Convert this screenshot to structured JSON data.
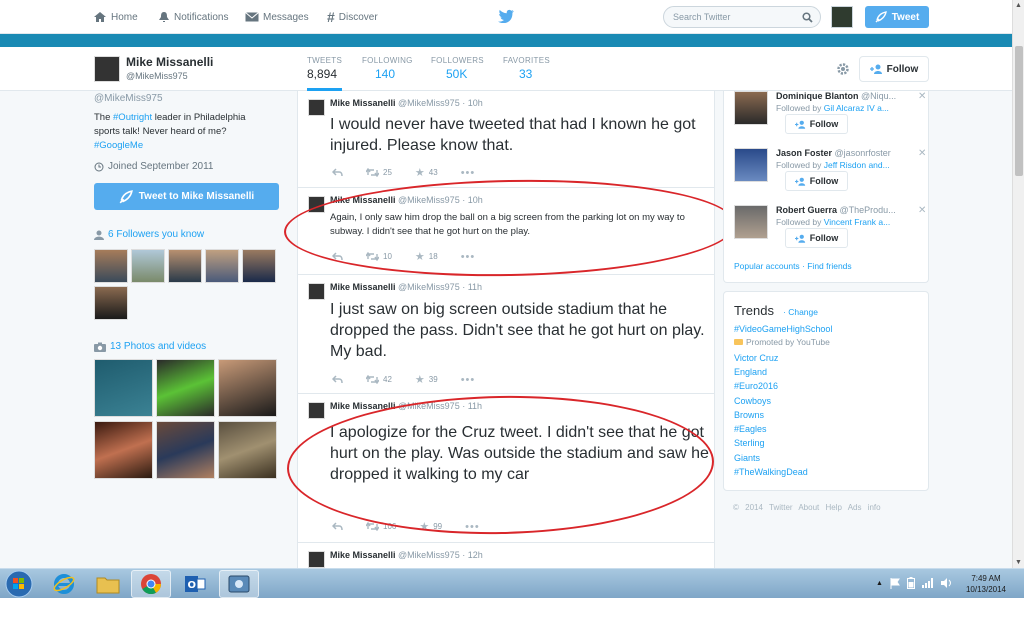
{
  "nav": {
    "home": "Home",
    "notifications": "Notifications",
    "messages": "Messages",
    "discover": "Discover",
    "search_placeholder": "Search Twitter",
    "tweet_button": "Tweet"
  },
  "profile": {
    "name": "Mike Missanelli",
    "handle": "@MikeMiss975",
    "stats": [
      {
        "label": "TWEETS",
        "value": "8,894"
      },
      {
        "label": "FOLLOWING",
        "value": "140"
      },
      {
        "label": "FOLLOWERS",
        "value": "50K"
      },
      {
        "label": "FAVORITES",
        "value": "33"
      }
    ],
    "follow_button": "Follow"
  },
  "sidebar": {
    "handle": "@MikeMiss975",
    "bio_pre": "The ",
    "bio_tag": "#Outright",
    "bio_mid": " leader in Philadelphia sports talk! Never heard of me? ",
    "bio_tag2": "#GoogleMe",
    "joined": "Joined September 2011",
    "tweet_to": "Tweet to Mike Missanelli",
    "followers_you_know": "6 Followers you know",
    "photos_videos": "13 Photos and videos"
  },
  "tweets": [
    {
      "name": "Mike Missanelli",
      "handle": "@MikeMiss975",
      "time": "10h",
      "text": "I would never have tweeted that had I known he got injured. Please know that.",
      "retweets": "25",
      "favorites": "43"
    },
    {
      "name": "Mike Missanelli",
      "handle": "@MikeMiss975",
      "time": "10h",
      "text": "Again, I only saw him drop the ball on a big screen from the parking lot on my way to subway. I didn't see that he got hurt on the play.",
      "retweets": "10",
      "favorites": "18"
    },
    {
      "name": "Mike Missanelli",
      "handle": "@MikeMiss975",
      "time": "11h",
      "text": "I just saw on big screen outside stadium that he dropped the pass. Didn't see that he got hurt on play. My bad.",
      "retweets": "42",
      "favorites": "39"
    },
    {
      "name": "Mike Missanelli",
      "handle": "@MikeMiss975",
      "time": "11h",
      "text": "I apologize for the Cruz tweet. I didn't see that he got hurt on the play. Was outside the stadium and saw he dropped it walking to my car",
      "retweets": "106",
      "favorites": "99"
    },
    {
      "name": "Mike Missanelli",
      "handle": "@MikeMiss975",
      "time": "12h"
    }
  ],
  "who_to_follow": [
    {
      "name": "Dominique Blanton",
      "handle": "@Niqu...",
      "followed_pre": "Followed by ",
      "followed_by": "Gil Alcaraz IV a...",
      "button": "Follow"
    },
    {
      "name": "Jason Foster",
      "handle": "@jasonrfoster",
      "followed_pre": "Followed by ",
      "followed_by": "Jeff Risdon and...",
      "button": "Follow"
    },
    {
      "name": "Robert Guerra",
      "handle": "@TheProdu...",
      "followed_pre": "Followed by ",
      "followed_by": "Vincent Frank a...",
      "button": "Follow"
    }
  ],
  "popular_links": "Popular accounts · Find friends",
  "trends": {
    "title": "Trends",
    "change": "Change",
    "promoted_tag": "#VideoGameHighSchool",
    "promoted_by": "Promoted by YouTube",
    "items": [
      "Victor Cruz",
      "England",
      "#Euro2016",
      "Cowboys",
      "Browns",
      "#Eagles",
      "Sterling",
      "Giants",
      "#TheWalkingDead"
    ]
  },
  "footer": "© 2014 Twitter About Help Ads info",
  "taskbar": {
    "time": "7:49 AM",
    "date": "10/13/2014"
  },
  "colors": {
    "twitter_blue": "#55acee",
    "link": "#1da1f2",
    "annotation_red": "#d9262a",
    "header_bar": "#1a8ab4"
  }
}
